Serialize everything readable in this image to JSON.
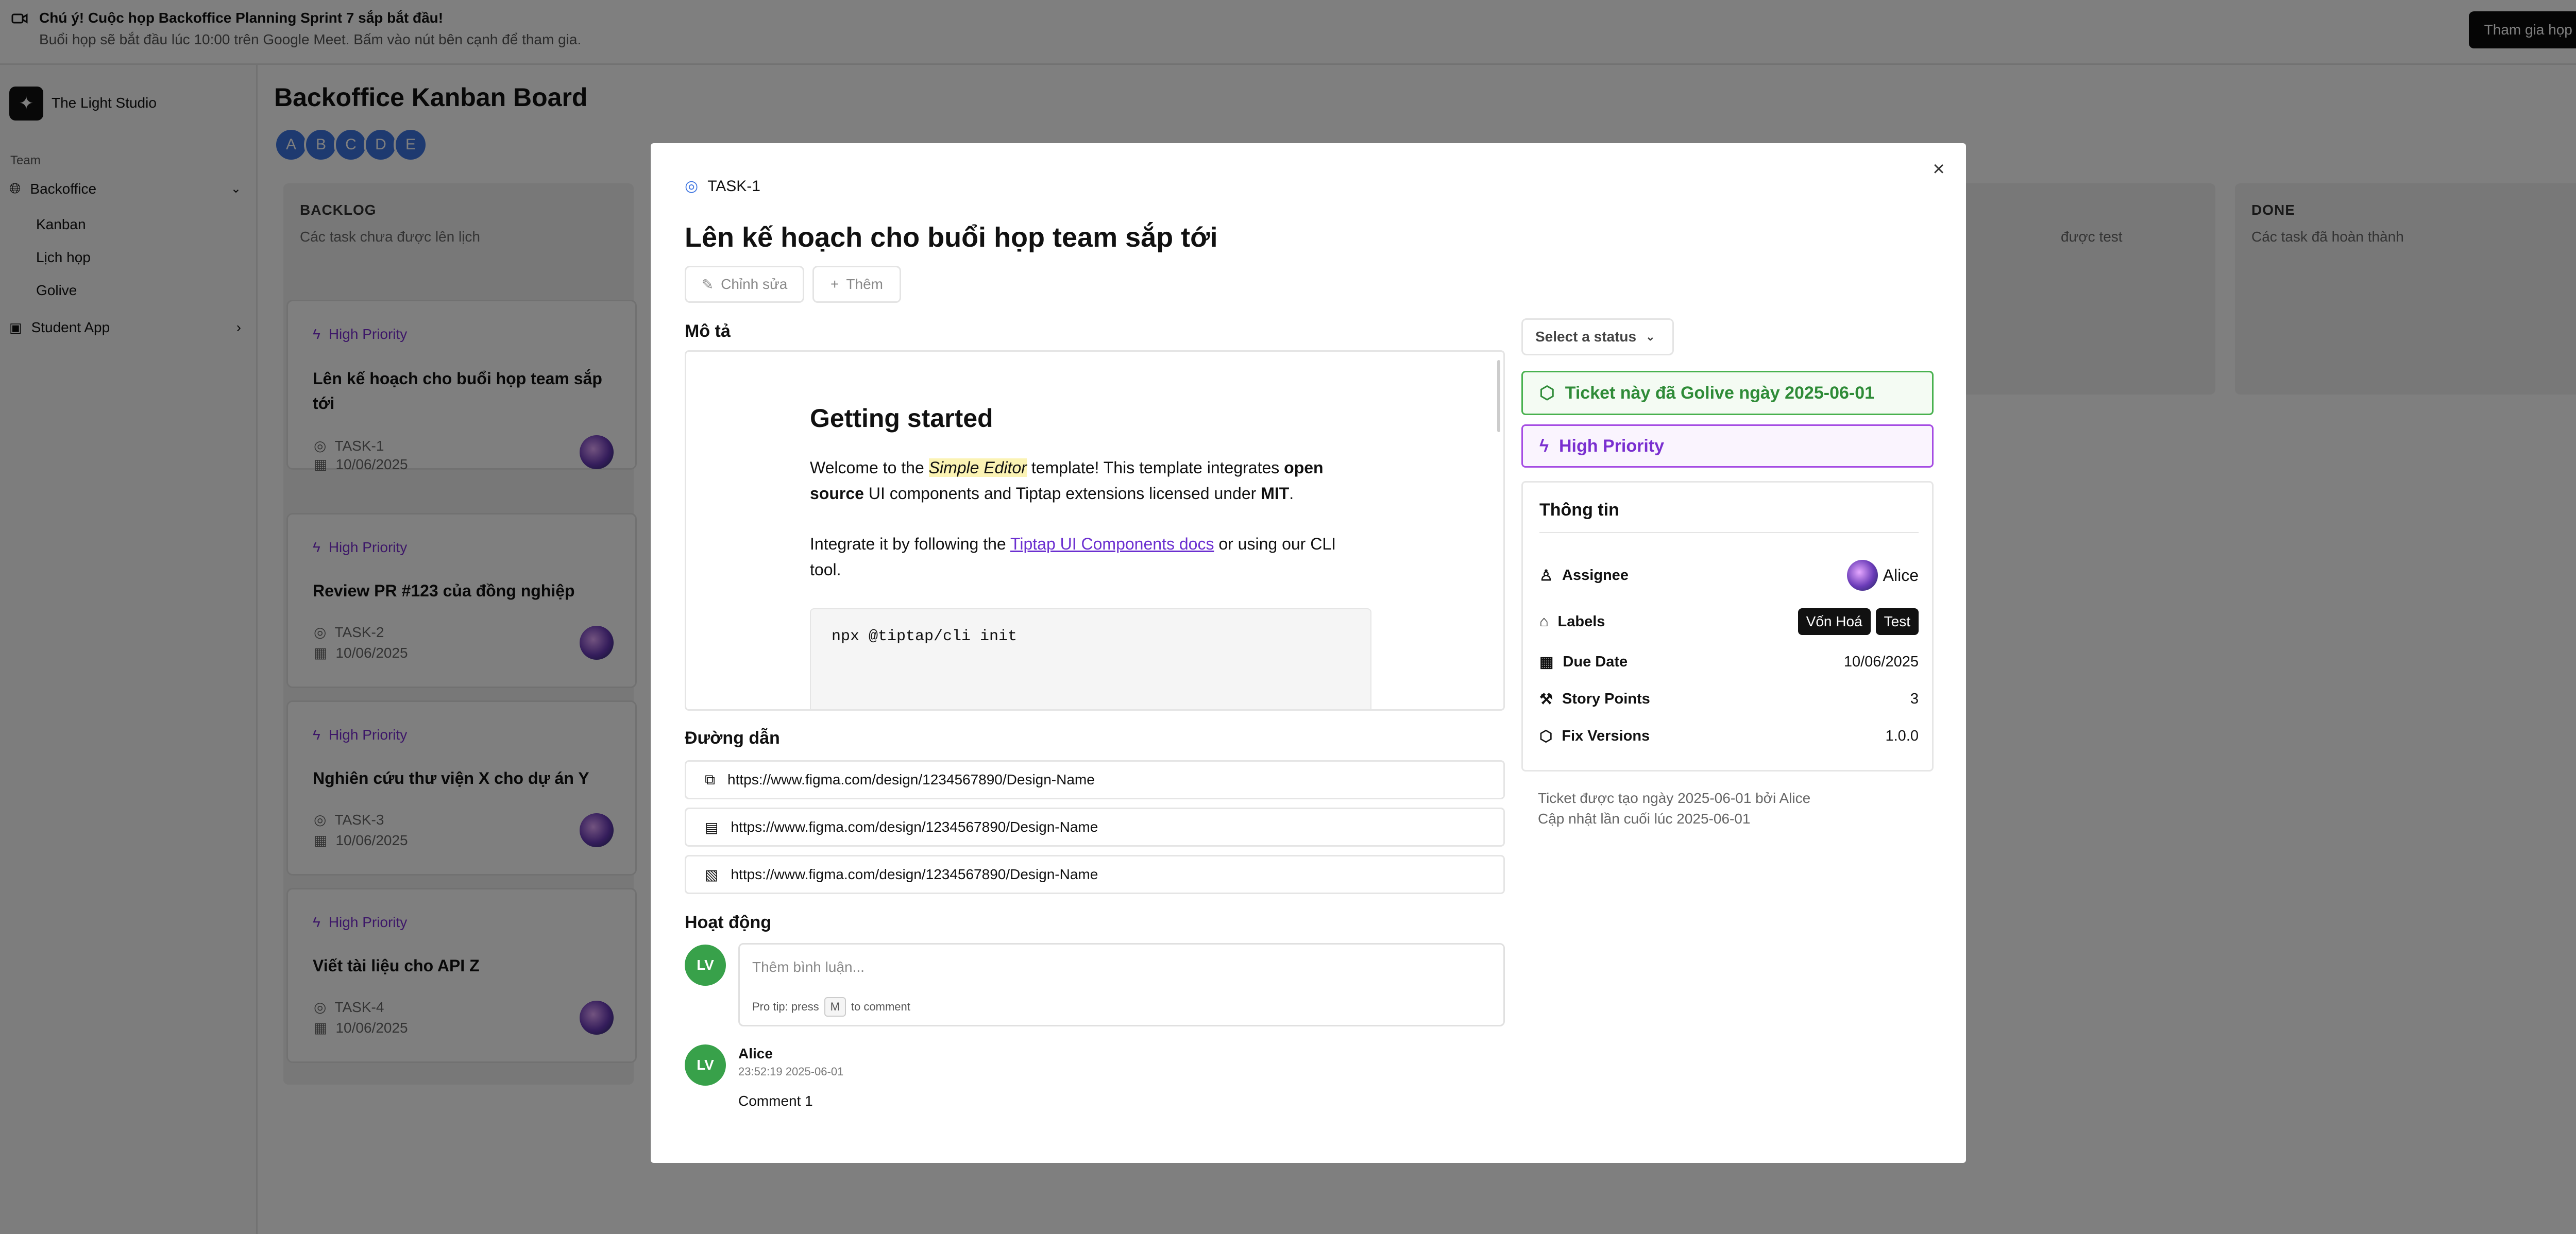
{
  "banner": {
    "title": "Chú ý! Cuộc họp Backoffice Planning Sprint 7 sắp bắt đầu!",
    "subtitle": "Buổi họp sẽ bắt đầu lúc 10:00 trên Google Meet. Bấm vào nút bên cạnh để tham gia.",
    "join_label": "Tham gia họp"
  },
  "sidebar": {
    "brand": "The Light Studio",
    "section": "Team",
    "team": "Backoffice",
    "items": [
      "Kanban",
      "Lịch họp",
      "Golive"
    ],
    "team2": "Student App"
  },
  "board": {
    "title": "Backoffice Kanban Board",
    "avatars": [
      "A",
      "B",
      "C",
      "D",
      "E"
    ],
    "columns": [
      {
        "name": "BACKLOG",
        "desc": "Các task chưa được lên lịch"
      },
      {
        "name": "",
        "desc": "được test"
      },
      {
        "name": "DONE",
        "desc": "Các task đã hoàn thành"
      }
    ],
    "cards": [
      {
        "priority": "High Priority",
        "title": "Lên kế hoạch cho buổi họp team sắp tới",
        "id": "TASK-1",
        "date": "10/06/2025"
      },
      {
        "priority": "High Priority",
        "title": "Review PR #123 của đồng nghiệp",
        "id": "TASK-2",
        "date": "10/06/2025"
      },
      {
        "priority": "High Priority",
        "title": "Nghiên cứu thư viện X cho dự án Y",
        "id": "TASK-3",
        "date": "10/06/2025"
      },
      {
        "priority": "High Priority",
        "title": "Viết tài liệu cho API Z",
        "id": "TASK-4",
        "date": "10/06/2025"
      }
    ]
  },
  "modal": {
    "task_id": "TASK-1",
    "title": "Lên kế hoạch cho buổi họp team sắp tới",
    "edit_label": "Chỉnh sửa",
    "add_label": "Thêm",
    "desc_label": "Mô tả",
    "editor": {
      "heading": "Getting started",
      "p1a": "Welcome to the ",
      "p1b": "Simple Editor",
      "p1c": " template! This template integrates ",
      "p1d": "open source",
      "p1e": " UI components and Tiptap extensions licensed under ",
      "p1f": "MIT",
      "p1g": ".",
      "p2a": "Integrate it by following the ",
      "p2b": "Tiptap UI Components docs",
      "p2c": " or using our CLI tool.",
      "code": "npx @tiptap/cli init"
    },
    "links_label": "Đường dẫn",
    "links": [
      "https://www.figma.com/design/1234567890/Design-Name",
      "https://www.figma.com/design/1234567890/Design-Name",
      "https://www.figma.com/design/1234567890/Design-Name"
    ],
    "activity_label": "Hoạt động",
    "commenter_initials": "LV",
    "comment_placeholder": "Thêm bình luận...",
    "tip_a": "Pro tip: press",
    "tip_key": "M",
    "tip_b": "to comment",
    "comment": {
      "author": "Alice",
      "time": "23:52:19 2025-06-01",
      "text": "Comment 1",
      "initials": "LV"
    },
    "status_placeholder": "Select a status",
    "golive_text": "Ticket này đã Golive ngày 2025-06-01",
    "priority_text": "High Priority",
    "info": {
      "title": "Thông tin",
      "assignee_label": "Assignee",
      "assignee": "Alice",
      "labels_label": "Labels",
      "labels": [
        "Vốn Hoá",
        "Test"
      ],
      "due_label": "Due Date",
      "due": "10/06/2025",
      "points_label": "Story Points",
      "points": "3",
      "fix_label": "Fix Versions",
      "fix": "1.0.0"
    },
    "created": "Ticket được tạo ngày 2025-06-01 bởi Alice",
    "updated": "Cập nhật lần cuối lúc 2025-06-01"
  },
  "colors": {
    "priority": "#7a2fd0",
    "golive": "#2e8b37",
    "avatar": "#3d74e0",
    "accent_green": "#38a14a"
  }
}
